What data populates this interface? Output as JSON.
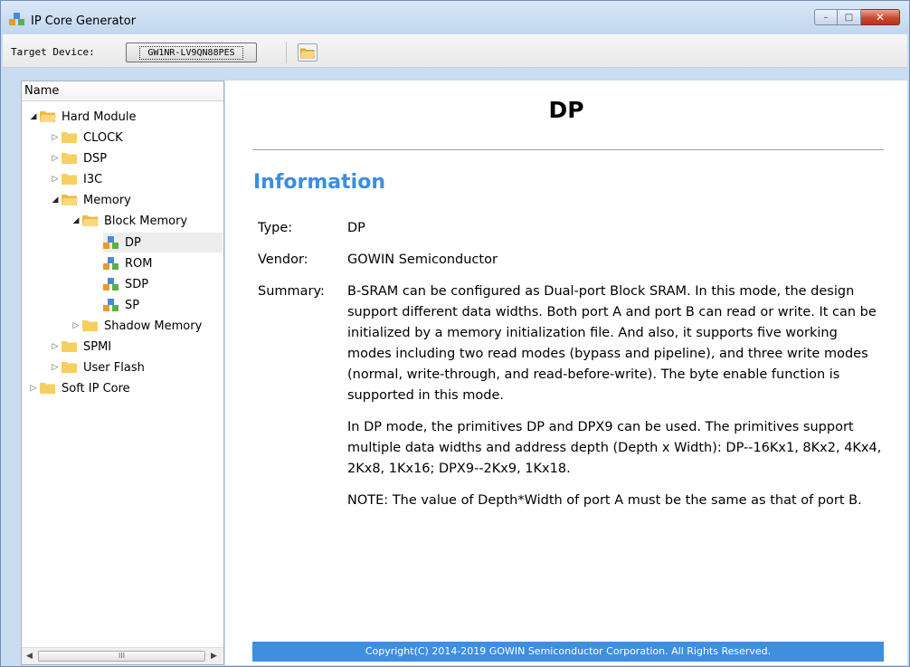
{
  "window": {
    "title": "IP Core Generator",
    "controls": {
      "minimize": "minimize-icon",
      "maximize": "maximize-icon",
      "close": "close-icon"
    }
  },
  "toolbar": {
    "target_label": "Target Device:",
    "device_value": "GW1NR-LV9QN88PES",
    "open_icon": "folder-open-icon"
  },
  "tree": {
    "header": "Name",
    "nodes": [
      {
        "label": "Hard Module",
        "expanded": true
      },
      {
        "label": "CLOCK"
      },
      {
        "label": "DSP"
      },
      {
        "label": "I3C"
      },
      {
        "label": "Memory",
        "expanded": true
      },
      {
        "label": "Block Memory",
        "expanded": true
      },
      {
        "label": "DP",
        "selected": true
      },
      {
        "label": "ROM"
      },
      {
        "label": "SDP"
      },
      {
        "label": "SP"
      },
      {
        "label": "Shadow Memory"
      },
      {
        "label": "SPMI"
      },
      {
        "label": "User Flash"
      },
      {
        "label": "Soft IP Core"
      }
    ],
    "scroll_thumb": "III"
  },
  "doc": {
    "title": "DP",
    "section": "Information",
    "type_key": "Type:",
    "type_value": "DP",
    "vendor_key": "Vendor:",
    "vendor_value": "GOWIN Semiconductor",
    "summary_key": "Summary:",
    "summary_p1": "B-SRAM can be configured as Dual-port Block SRAM. In this mode, the design support different data widths. Both port A and port B can read or write. It can be initialized by a memory initialization file. And also, it supports five working modes including two read modes (bypass and pipeline), and three write modes (normal, write-through, and read-before-write). The byte enable function is supported in this mode.",
    "summary_p2": "In DP mode, the primitives DP and DPX9 can be used. The primitives support multiple data widths and address depth (Depth x Width): DP--16Kx1, 8Kx2, 4Kx4, 2Kx8, 1Kx16; DPX9--2Kx9, 1Kx18.",
    "summary_p3": "NOTE: The value of Depth*Width of port A must be the same as that of port B.",
    "footer": "Copyright(C) 2014-2019 GOWIN Semiconductor Corporation. All Rights Reserved."
  },
  "colors": {
    "accent": "#3a8ee0",
    "footer_bg": "#3e8fe0",
    "folder": "#f5c95a",
    "window_frame": "#c9dcf0"
  }
}
